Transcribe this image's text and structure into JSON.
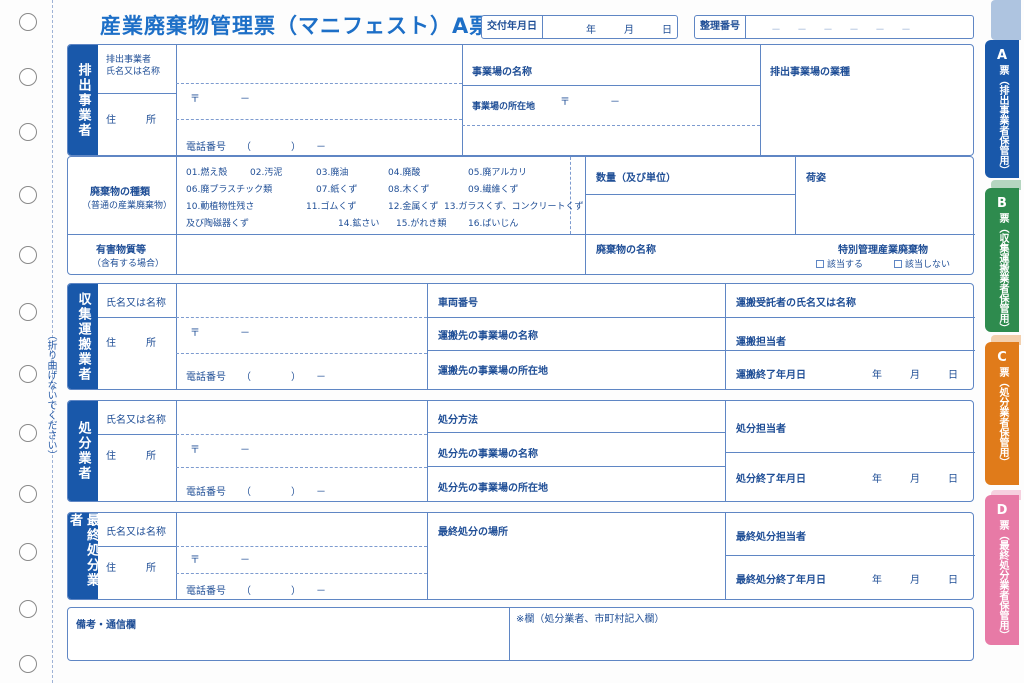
{
  "header": {
    "title": "産業廃棄物管理票（マニフェスト）A票",
    "issue_date_label": "交付年月日",
    "year": "年",
    "month": "月",
    "day": "日",
    "ref_label": "整理番号",
    "ref_dashes": "－　－　－　－　－　－"
  },
  "fold_note": "（折り曲げないでください）",
  "postal": "〒　　　　－",
  "phone": "電話番号　　（　　　　）　　－",
  "name_label": "氏名又は名称",
  "address_label": "住　　　所",
  "emitter": {
    "side": "排出事業者",
    "name_label": "排出事業者\n氏名又は名称",
    "site_name": "事業場の名称",
    "site_address": "事業場の所在地",
    "site_postal": "〒　　　　－",
    "industry": "排出事業場の業種"
  },
  "waste": {
    "type_label": "廃棄物の種類",
    "type_sub": "（普通の産業廃棄物）",
    "rows": [
      [
        "01.燃え殻",
        "02.汚泥",
        "03.廃油",
        "04.廃酸",
        "05.廃アルカリ"
      ],
      [
        "06.廃プラスチック類",
        "07.紙くず",
        "08.木くず",
        "09.繊維くず"
      ],
      [
        "10.動植物性残さ",
        "11.ゴムくず",
        "12.金属くず",
        "13.ガラスくず、コンクリートくず"
      ],
      [
        "及び陶磁器くず",
        "14.鉱さい",
        "15.がれき類",
        "16.ばいじん"
      ]
    ],
    "quantity": "数量（及び単位）",
    "packing": "荷姿",
    "hazard_label": "有害物質等",
    "hazard_sub": "（含有する場合）",
    "waste_name": "廃棄物の名称",
    "special_label": "特別管理産業廃棄物",
    "applies": "該当する",
    "not_applies": "該当しない"
  },
  "transport": {
    "side": "収集運搬業者",
    "vehicle": "車両番号",
    "dest_name": "運搬先の事業場の名称",
    "dest_address": "運搬先の事業場の所在地",
    "recipient": "運搬受託者の氏名又は名称",
    "person": "運搬担当者",
    "end_date": "運搬終了年月日"
  },
  "disposal": {
    "side": "処分業者",
    "method": "処分方法",
    "dest_name": "処分先の事業場の名称",
    "dest_address": "処分先の事業場の所在地",
    "person": "処分担当者",
    "end_date": "処分終了年月日"
  },
  "final": {
    "side": "最終処分業者",
    "place": "最終処分の場所",
    "person": "最終処分担当者",
    "end_date": "最終処分終了年月日"
  },
  "notes": {
    "remarks": "備考・通信欄",
    "star": "※欄（処分業者、市町村記入欄）"
  },
  "tabs": [
    {
      "letter": "A",
      "text": "票（排出事業者保管用）",
      "color": "#1958aa"
    },
    {
      "letter": "B",
      "text": "票（収集運搬業者保管用）",
      "color": "#2e8b4e"
    },
    {
      "letter": "C",
      "text": "票（処分業者保管用）",
      "color": "#e07b1a"
    },
    {
      "letter": "D",
      "text": "票（最終処分業者保管用）",
      "color": "#e77aa6"
    }
  ]
}
